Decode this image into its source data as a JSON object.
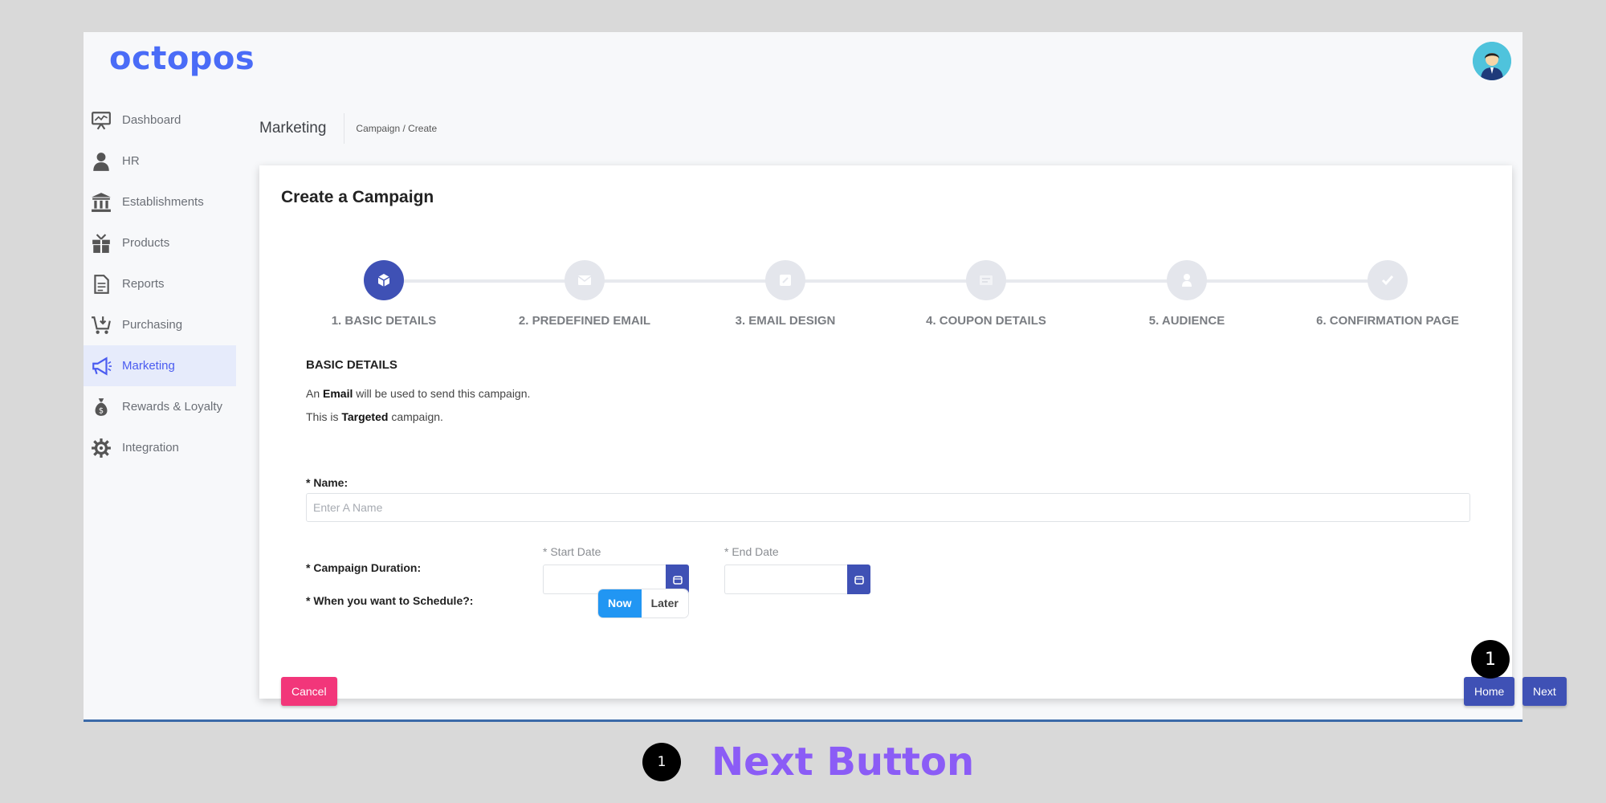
{
  "app": {
    "logo": "octopos",
    "avatar_icon": "user-avatar-icon"
  },
  "sidebar": {
    "items": [
      {
        "label": "Dashboard",
        "icon": "dashboard-icon",
        "active": false
      },
      {
        "label": "HR",
        "icon": "person-icon",
        "active": false
      },
      {
        "label": "Establishments",
        "icon": "bank-icon",
        "active": false
      },
      {
        "label": "Products",
        "icon": "gift-icon",
        "active": false
      },
      {
        "label": "Reports",
        "icon": "document-icon",
        "active": false
      },
      {
        "label": "Purchasing",
        "icon": "cart-icon",
        "active": false
      },
      {
        "label": "Marketing",
        "icon": "megaphone-icon",
        "active": true
      },
      {
        "label": "Rewards & Loyalty",
        "icon": "money-bag-icon",
        "active": false
      },
      {
        "label": "Integration",
        "icon": "gear-icon",
        "active": false
      }
    ]
  },
  "header": {
    "title": "Marketing",
    "breadcrumb": "Campaign / Create"
  },
  "card": {
    "title": "Create a Campaign",
    "steps": [
      {
        "label": "1. BASIC DETAILS",
        "icon": "cube-icon",
        "active": true
      },
      {
        "label": "2. PREDEFINED EMAIL",
        "icon": "envelope-icon",
        "active": false
      },
      {
        "label": "3. EMAIL DESIGN",
        "icon": "edit-icon",
        "active": false
      },
      {
        "label": "4. COUPON DETAILS",
        "icon": "coupon-icon",
        "active": false
      },
      {
        "label": "5. AUDIENCE",
        "icon": "user-icon",
        "active": false
      },
      {
        "label": "6. CONFIRMATION PAGE",
        "icon": "check-icon",
        "active": false
      }
    ],
    "section_title": "BASIC DETAILS",
    "info1": {
      "pre": "An ",
      "bold": "Email",
      "post": " will be used to send this campaign."
    },
    "info2": {
      "pre": "This is ",
      "bold": "Targeted",
      "post": " campaign."
    },
    "name": {
      "label": "* Name:",
      "placeholder": "Enter A Name",
      "value": ""
    },
    "duration": {
      "label": "* Campaign Duration:",
      "start_label": "* Start Date",
      "start_value": "",
      "end_label": "* End Date",
      "end_value": ""
    },
    "schedule": {
      "label": "* When you want to Schedule?:",
      "options": [
        "Now",
        "Later"
      ],
      "selected": "Now"
    },
    "buttons": {
      "cancel": "Cancel",
      "home": "Home",
      "next": "Next"
    }
  },
  "annotation": {
    "marker_number": "1",
    "caption": "Next Button"
  },
  "colors": {
    "primary": "#3f51b5",
    "brand": "#4a6cf7",
    "cancel": "#f2367a",
    "toggle_on": "#2196f3",
    "caption": "#8b5cf6"
  }
}
